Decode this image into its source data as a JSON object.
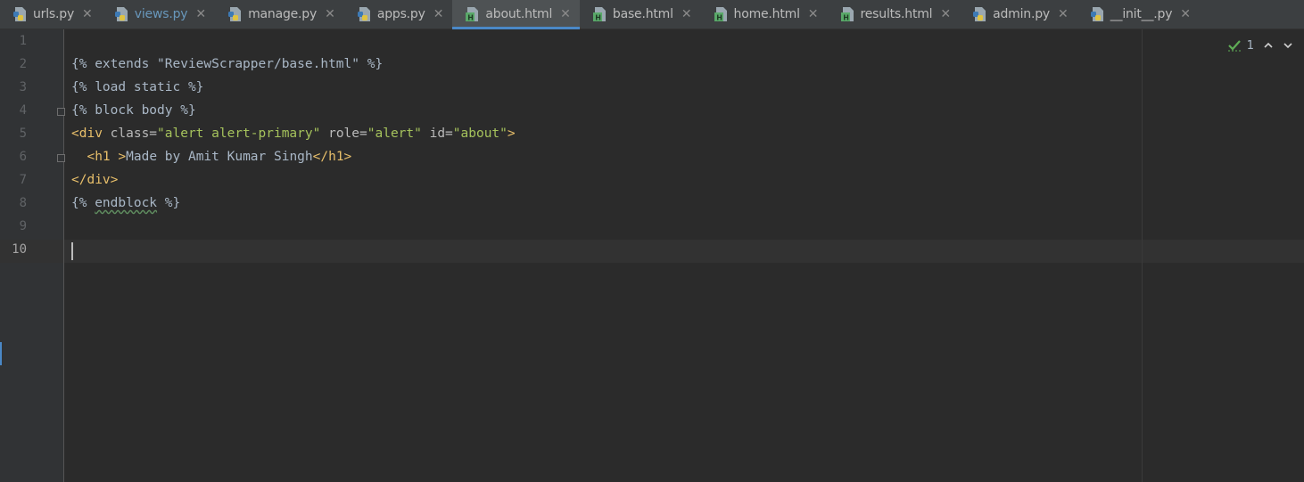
{
  "tabs": [
    {
      "label": "urls.py",
      "icon": "python-file-icon",
      "active": false
    },
    {
      "label": "views.py",
      "icon": "python-file-icon",
      "active": false,
      "modified": true
    },
    {
      "label": "manage.py",
      "icon": "python-file-icon",
      "active": false
    },
    {
      "label": "apps.py",
      "icon": "python-file-icon",
      "active": false
    },
    {
      "label": "about.html",
      "icon": "html-file-icon",
      "active": true
    },
    {
      "label": "base.html",
      "icon": "html-file-icon",
      "active": false
    },
    {
      "label": "home.html",
      "icon": "html-file-icon",
      "active": false
    },
    {
      "label": "results.html",
      "icon": "html-file-icon",
      "active": false
    },
    {
      "label": "admin.py",
      "icon": "python-file-icon",
      "active": false
    },
    {
      "label": "__init__.py",
      "icon": "python-file-icon",
      "active": false
    }
  ],
  "close_glyph": "✕",
  "inspection": {
    "count": "1",
    "check_icon": "check-icon",
    "up_icon": "arrow-up-icon",
    "down_icon": "arrow-down-icon"
  },
  "line_numbers": [
    "1",
    "2",
    "3",
    "4",
    "5",
    "6",
    "7",
    "8",
    "9",
    "10"
  ],
  "current_line": "10",
  "code": {
    "l1": "{% extends \"ReviewScrapper/base.html\" %}",
    "l2": "{% load static %}",
    "l3": "{% block body %}",
    "l4": {
      "open": "<div",
      "a1": " class=",
      "v1": "\"alert alert-primary\"",
      "a2": " role=",
      "v2": "\"alert\"",
      "a3": " id=",
      "v3": "\"about\"",
      "close": ">"
    },
    "l5": {
      "indent": "  ",
      "open": "<h1 >",
      "text": "Made by Amit Kumar Singh",
      "close": "</h1>"
    },
    "l6": "</div>",
    "l7": {
      "pre": "{% ",
      "kw": "endblock",
      "post": " %}"
    }
  },
  "colors": {
    "background": "#2b2b2b",
    "gutter": "#313335",
    "tag": "#e8bf6a",
    "string": "#a5c25c",
    "text": "#a9b7c6",
    "active_tab_underline": "#4a88c7"
  }
}
